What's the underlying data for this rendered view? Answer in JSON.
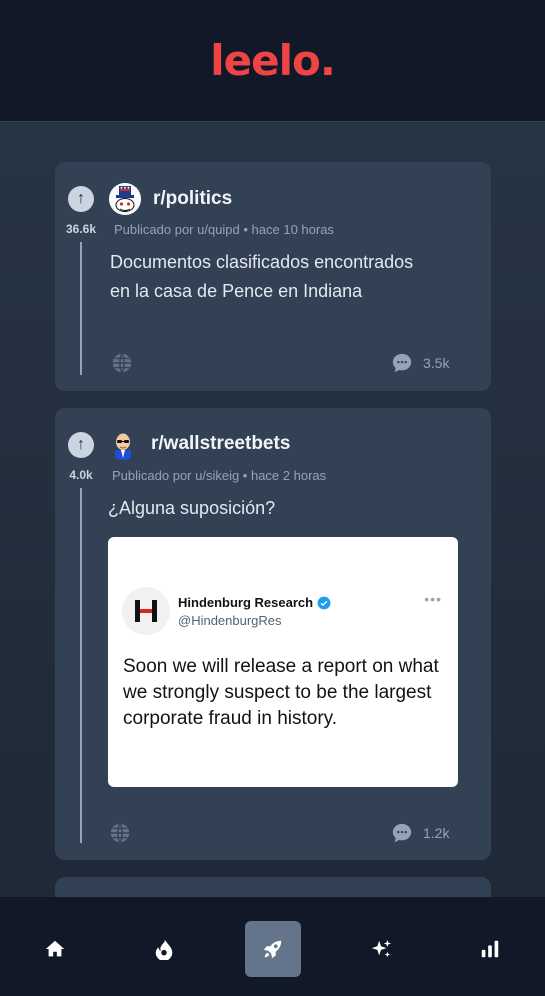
{
  "app": {
    "logo": "leelo."
  },
  "posts": [
    {
      "votes": "36.6k",
      "subreddit": "r/politics",
      "meta": "Publicado por u/quipd • hace 10 horas",
      "title_lines": [
        "Documentos clasificados encontrados",
        "en la casa de Pence en Indiana"
      ],
      "comments": "3.5k"
    },
    {
      "votes": "4.0k",
      "subreddit": "r/wallstreetbets",
      "meta": "Publicado por u/sikeig • hace 2 horas",
      "title": "¿Alguna suposición?",
      "comments": "1.2k",
      "tweet": {
        "name": "Hindenburg Research",
        "handle": "@HindenburgRes",
        "more": "•••",
        "text": "Soon we will release a report on what we strongly suspect to be the largest corporate fraud in history."
      }
    }
  ],
  "nav": {
    "items": [
      "home-icon",
      "fire-icon",
      "rocket-icon",
      "sparkles-icon",
      "chart-icon"
    ],
    "active": "rocket-icon"
  },
  "colors": {
    "accent": "#ef4444",
    "background": "#1f2937",
    "card": "#334155",
    "nav_active": "#64748b"
  }
}
